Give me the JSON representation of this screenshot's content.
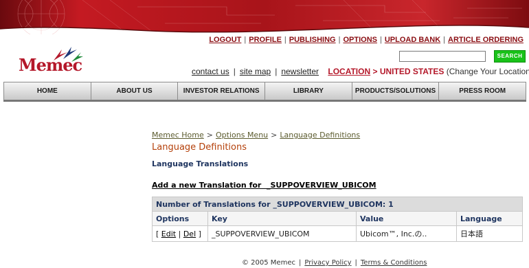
{
  "header": {
    "logo_text": "Memec",
    "top_links": [
      "LOGOUT",
      "PROFILE",
      "PUBLISHING",
      "OPTIONS",
      "UPLOAD BANK",
      "ARTICLE ORDERING"
    ],
    "search": {
      "value": "",
      "button": "SEARCH"
    },
    "util_links": [
      "contact us",
      "site map",
      "newsletter"
    ],
    "location_label": "LOCATION",
    "location_value": "> UNITED STATES",
    "change_location": "(Change Your Location)"
  },
  "nav": [
    "HOME",
    "ABOUT US",
    "INVESTOR RELATIONS",
    "LIBRARY",
    "PRODUCTS/SOLUTIONS",
    "PRESS ROOM"
  ],
  "breadcrumb": [
    "Memec Home",
    "Options Menu",
    "Language Definitions"
  ],
  "breadcrumb_sep": ">",
  "page_title": "Language Definitions",
  "section_title": "Language Translations",
  "add_link": "Add a new Translation for  _SUPPOVERVIEW_UBICOM",
  "table": {
    "count_text": "Number of Translations for _SUPPOVERVIEW_UBICOM: 1",
    "columns": [
      "Options",
      "Key",
      "Value",
      "Language"
    ],
    "rows": [
      {
        "open": "[",
        "edit": "Edit",
        "pipe": "|",
        "del": "Del",
        "close": "]",
        "key": "_SUPPOVERVIEW_UBICOM",
        "value": "Ubicom™, Inc.の..",
        "language": "日本語"
      }
    ]
  },
  "footer": {
    "copyright": "© 2005 Memec",
    "links": [
      "Privacy Policy",
      "Terms & Conditions"
    ]
  },
  "colors": {
    "banner": "#b0151c",
    "brand": "#b4182a",
    "search_button": "#19c219",
    "heading": "#1f3560",
    "title": "#b4400a"
  }
}
